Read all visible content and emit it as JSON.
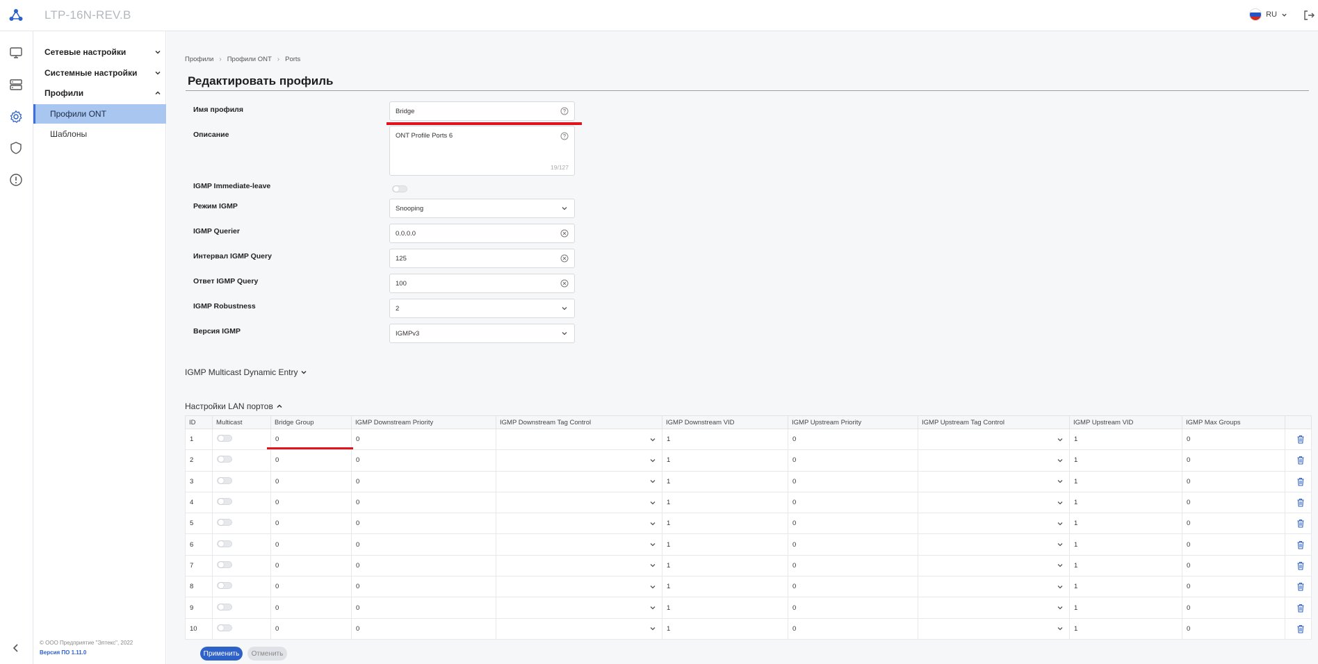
{
  "header": {
    "title": "LTP-16N-REV.B",
    "lang": "RU"
  },
  "colors": {
    "accent": "#2f62c8",
    "active_bg": "#a9c6f0",
    "highlight": "#e0141c"
  },
  "rail_icons": [
    "monitor-icon",
    "server-icon",
    "gear-icon",
    "shield-icon",
    "alert-icon"
  ],
  "sidebar": {
    "groups": [
      {
        "label": "Сетевые настройки",
        "expanded": false
      },
      {
        "label": "Системные настройки",
        "expanded": false
      },
      {
        "label": "Профили",
        "expanded": true
      }
    ],
    "items": [
      {
        "label": "Профили ONT",
        "active": true
      },
      {
        "label": "Шаблоны",
        "active": false
      }
    ],
    "copyright": "© ООО Предприятие \"Элтекс\", 2022",
    "version": "Версия ПО 1.11.0"
  },
  "breadcrumb": [
    "Профили",
    "Профили ONT",
    "Ports"
  ],
  "page_title": "Редактировать профиль",
  "form": {
    "profile_name": {
      "label": "Имя профиля",
      "value": "Bridge"
    },
    "description": {
      "label": "Описание",
      "value": "ONT Profile Ports 6",
      "counter": "19/127"
    },
    "immediate_leave": {
      "label": "IGMP Immediate-leave"
    },
    "igmp_mode": {
      "label": "Режим IGMP",
      "value": "Snooping"
    },
    "querier": {
      "label": "IGMP Querier",
      "value": "0.0.0.0"
    },
    "query_interval": {
      "label": "Интервал IGMP Query",
      "value": "125"
    },
    "query_response": {
      "label": "Ответ IGMP Query",
      "value": "100"
    },
    "robustness": {
      "label": "IGMP Robustness",
      "value": "2"
    },
    "version": {
      "label": "Версия IGMP",
      "value": "IGMPv3"
    }
  },
  "sections": {
    "multicast_dynamic": "IGMP Multicast Dynamic Entry",
    "lan_ports": "Настройки LAN портов"
  },
  "table": {
    "headers": [
      "ID",
      "Multicast",
      "Bridge Group",
      "IGMP Downstream Priority",
      "IGMP Downstream Tag Control",
      "IGMP Downstream VID",
      "IGMP Upstream Priority",
      "IGMP Upstream Tag Control",
      "IGMP Upstream VID",
      "IGMP Max Groups",
      ""
    ],
    "rows": [
      {
        "id": "1",
        "bridge_group": "0",
        "ds_priority": "0",
        "ds_vid": "1",
        "us_priority": "0",
        "us_vid": "1",
        "max_groups": "0"
      },
      {
        "id": "2",
        "bridge_group": "0",
        "ds_priority": "0",
        "ds_vid": "1",
        "us_priority": "0",
        "us_vid": "1",
        "max_groups": "0"
      },
      {
        "id": "3",
        "bridge_group": "0",
        "ds_priority": "0",
        "ds_vid": "1",
        "us_priority": "0",
        "us_vid": "1",
        "max_groups": "0"
      },
      {
        "id": "4",
        "bridge_group": "0",
        "ds_priority": "0",
        "ds_vid": "1",
        "us_priority": "0",
        "us_vid": "1",
        "max_groups": "0"
      },
      {
        "id": "5",
        "bridge_group": "0",
        "ds_priority": "0",
        "ds_vid": "1",
        "us_priority": "0",
        "us_vid": "1",
        "max_groups": "0"
      },
      {
        "id": "6",
        "bridge_group": "0",
        "ds_priority": "0",
        "ds_vid": "1",
        "us_priority": "0",
        "us_vid": "1",
        "max_groups": "0"
      },
      {
        "id": "7",
        "bridge_group": "0",
        "ds_priority": "0",
        "ds_vid": "1",
        "us_priority": "0",
        "us_vid": "1",
        "max_groups": "0"
      },
      {
        "id": "8",
        "bridge_group": "0",
        "ds_priority": "0",
        "ds_vid": "1",
        "us_priority": "0",
        "us_vid": "1",
        "max_groups": "0"
      },
      {
        "id": "9",
        "bridge_group": "0",
        "ds_priority": "0",
        "ds_vid": "1",
        "us_priority": "0",
        "us_vid": "1",
        "max_groups": "0"
      },
      {
        "id": "10",
        "bridge_group": "0",
        "ds_priority": "0",
        "ds_vid": "1",
        "us_priority": "0",
        "us_vid": "1",
        "max_groups": "0"
      }
    ]
  },
  "buttons": {
    "apply": "Применить",
    "cancel": "Отменить"
  }
}
